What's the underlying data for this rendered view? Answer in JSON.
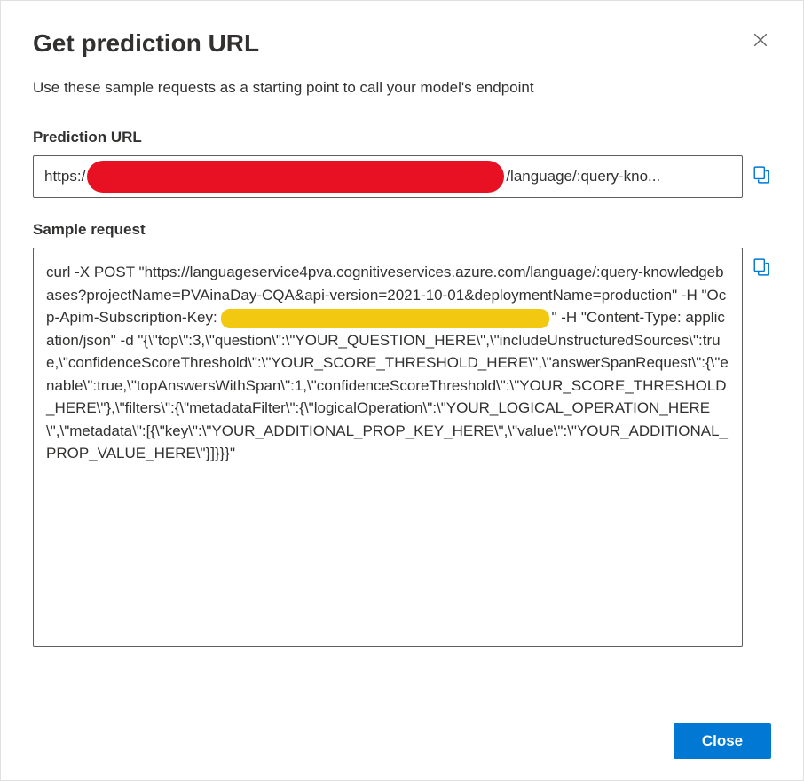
{
  "dialog": {
    "title": "Get prediction URL",
    "subtitle": "Use these sample requests as a starting point to call your model's endpoint"
  },
  "predictionUrl": {
    "label": "Prediction URL",
    "prefix": "https:/",
    "suffix": "/language/:query-kno..."
  },
  "sampleRequest": {
    "label": "Sample request",
    "part1": "curl -X POST \"https://languageservice4pva.cognitiveservices.azure.com/language/:query-knowledgebases?projectName=PVAinaDay-CQA&api-version=2021-10-01&deploymentName=production\" -H \"Ocp-Apim-Subscription-Key: ",
    "part2": "\" -H \"Content-Type: application/json\" -d \"{\\\"top\\\":3,\\\"question\\\":\\\"YOUR_QUESTION_HERE\\\",\\\"includeUnstructuredSources\\\":true,\\\"confidenceScoreThreshold\\\":\\\"YOUR_SCORE_THRESHOLD_HERE\\\",\\\"answerSpanRequest\\\":{\\\"enable\\\":true,\\\"topAnswersWithSpan\\\":1,\\\"confidenceScoreThreshold\\\":\\\"YOUR_SCORE_THRESHOLD_HERE\\\"},\\\"filters\\\":{\\\"metadataFilter\\\":{\\\"logicalOperation\\\":\\\"YOUR_LOGICAL_OPERATION_HERE\\\",\\\"metadata\\\":[{\\\"key\\\":\\\"YOUR_ADDITIONAL_PROP_KEY_HERE\\\",\\\"value\\\":\\\"YOUR_ADDITIONAL_PROP_VALUE_HERE\\\"}]}}}\""
  },
  "footer": {
    "closeLabel": "Close"
  }
}
